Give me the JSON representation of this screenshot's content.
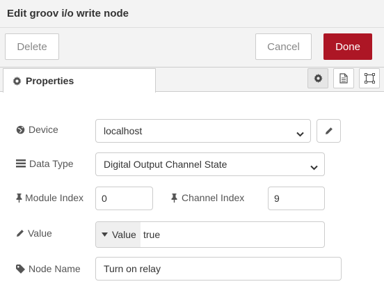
{
  "dialog": {
    "title": "Edit groov i/o write node"
  },
  "buttons": {
    "delete": "Delete",
    "cancel": "Cancel",
    "done": "Done"
  },
  "tabs": {
    "properties": "Properties"
  },
  "form": {
    "device": {
      "label": "Device",
      "value": "localhost"
    },
    "data_type": {
      "label": "Data Type",
      "value": "Digital Output Channel State"
    },
    "module_index": {
      "label": "Module Index",
      "value": "0"
    },
    "channel_index": {
      "label": "Channel Index",
      "value": "9"
    },
    "value": {
      "label": "Value",
      "type": "Value",
      "value": "true"
    },
    "node_name": {
      "label": "Node Name",
      "value": "Turn on relay"
    }
  },
  "icons": {
    "tab": "gear-icon",
    "device": "globe-icon",
    "data_type": "list-icon",
    "index": "thumbtack-icon",
    "value": "pencil-icon",
    "node_name": "tag-icon"
  },
  "colors": {
    "done_button": "#ad1625",
    "panel_background": "#f3f3f3",
    "border": "#cccccc"
  }
}
